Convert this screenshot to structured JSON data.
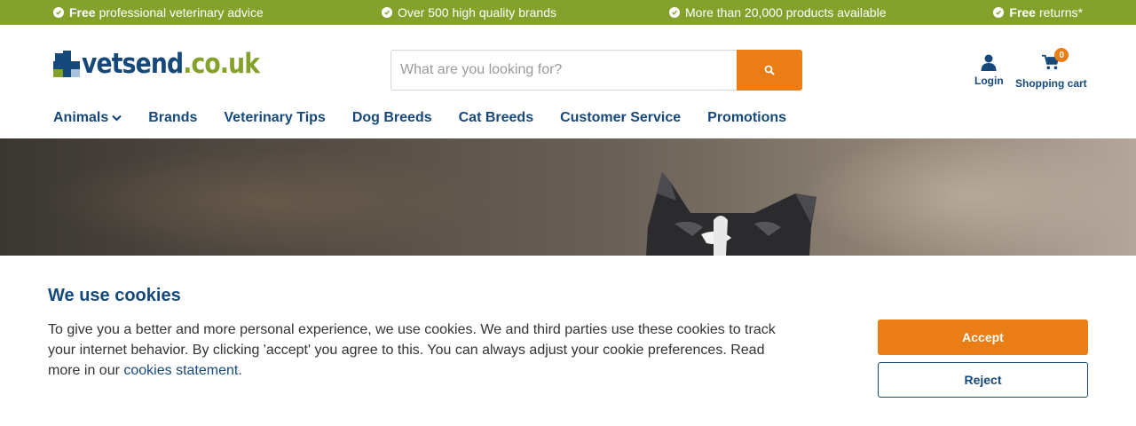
{
  "usp_bar": {
    "items": [
      {
        "bold": "Free",
        "text": " professional veterinary advice"
      },
      {
        "bold": "",
        "text": "Over 500 high quality brands"
      },
      {
        "bold": "",
        "text": "More than 20,000 products available"
      },
      {
        "bold": "Free",
        "text": " returns*"
      }
    ]
  },
  "header": {
    "logo": {
      "part1": "vetsend",
      "part2": ".co.uk"
    },
    "search": {
      "placeholder": "What are you looking for?",
      "value": ""
    },
    "account": {
      "login_label": "Login",
      "cart_label": "Shopping cart",
      "cart_count": "0"
    }
  },
  "nav": {
    "items": [
      "Animals",
      "Brands",
      "Veterinary Tips",
      "Dog Breeds",
      "Cat Breeds",
      "Customer Service",
      "Promotions"
    ]
  },
  "cookie_banner": {
    "title": "We use cookies",
    "body": "To give you a better and more personal experience, we use cookies. We and third parties use these cookies to track your internet behavior. By clicking 'accept' you agree to this. You can always adjust your cookie preferences. Read more in our ",
    "link": "cookies statement",
    "period": ".",
    "accept_label": "Accept",
    "reject_label": "Reject"
  },
  "colors": {
    "brand_blue": "#16497a",
    "brand_green": "#84a22b",
    "accent_orange": "#ea7d16"
  },
  "icons": [
    "check-circle-icon",
    "search-icon",
    "user-icon",
    "cart-icon",
    "chevron-down-icon"
  ]
}
